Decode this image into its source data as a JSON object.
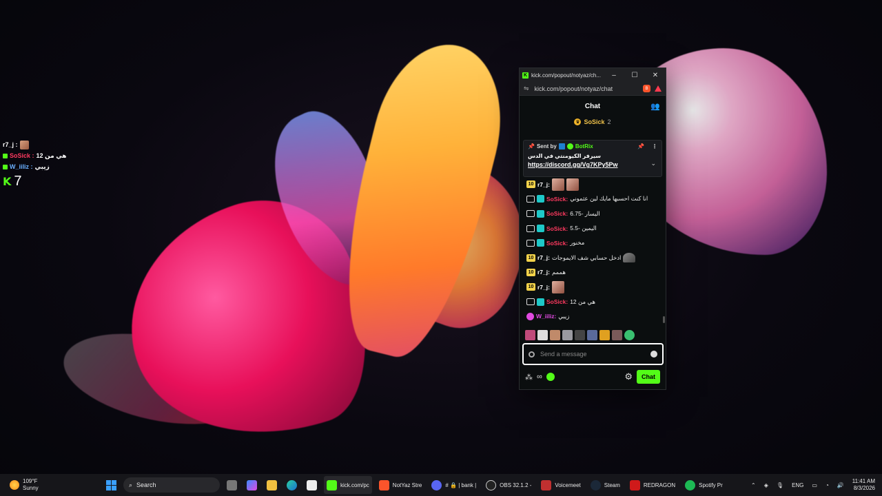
{
  "overlay": {
    "rows": [
      {
        "name": "r7_j :",
        "text": ""
      },
      {
        "name": "SoSick :",
        "text": "هي من 12"
      },
      {
        "name": "W_iiliz :",
        "text": "زيبي"
      }
    ],
    "viewer_count": "7"
  },
  "window": {
    "title": "kick.com/popout/notyaz/ch...",
    "url": "kick.com/popout/notyaz/chat",
    "controls": {
      "minimize": "–",
      "maximize": "☐",
      "close": "✕"
    }
  },
  "chat": {
    "header": "Chat",
    "top_gifter": {
      "name": "SoSick",
      "count": "2"
    },
    "pinned": {
      "sent_by": "Sent by",
      "bot_name": "BotRix",
      "message": "سيرفر الكيومنتي في الدس",
      "link": "https://discord.gg/Vg7KPy5Pw"
    },
    "messages": [
      {
        "user": "r7_j:",
        "text": "",
        "color": "#ffffff"
      },
      {
        "user": "SoSick:",
        "text": "انا كنت احسبها مايك لين عثموني",
        "color": "#ff3a60"
      },
      {
        "user": "SoSick:",
        "text": "اليسار -6.75",
        "color": "#ff3a60"
      },
      {
        "user": "SoSick:",
        "text": "اليمين -5.5",
        "color": "#ff3a60"
      },
      {
        "user": "SoSick:",
        "text": "مخنور",
        "color": "#ff3a60"
      },
      {
        "user": "r7_j:",
        "text": "ادخل حسابي شف الايموجات",
        "color": "#ffffff"
      },
      {
        "user": "r7_j:",
        "text": "هممم",
        "color": "#ffffff"
      },
      {
        "user": "r7_j:",
        "text": "",
        "color": "#ffffff"
      },
      {
        "user": "SoSick:",
        "text": "هي من 12",
        "color": "#ff3a60"
      },
      {
        "user": "W_iiliz:",
        "text": "زيبي",
        "color": "#e04ae0"
      }
    ],
    "input_placeholder": "Send a message",
    "send_label": "Chat",
    "badge_ten": "10"
  },
  "taskbar": {
    "weather": {
      "temp": "109°F",
      "condition": "Sunny"
    },
    "search_label": "Search",
    "apps": [
      {
        "label": "kick.com/pc",
        "icon": "kick-icon"
      },
      {
        "label": "NotYaz Stre",
        "icon": "brave-icon"
      },
      {
        "label": "# 🔒 | bank |",
        "icon": "discord-icon"
      },
      {
        "label": "OBS 32.1.2 -",
        "icon": "obs-icon"
      },
      {
        "label": "Voicemeet",
        "icon": "voicemeeter-icon"
      },
      {
        "label": "Steam",
        "icon": "steam-icon"
      },
      {
        "label": "REDRAGON",
        "icon": "redragon-icon"
      },
      {
        "label": "Spotify Pr",
        "icon": "spotify-icon"
      }
    ],
    "lang": "ENG",
    "time": "11:41 AM",
    "date": "8/3/2026"
  },
  "colors": {
    "kick_green": "#53fc18",
    "user_red": "#ff3a60"
  }
}
